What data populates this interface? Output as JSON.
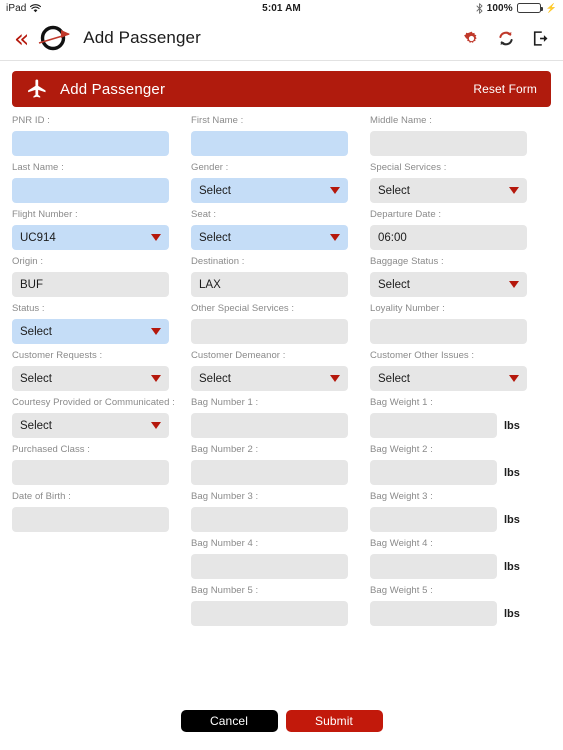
{
  "status_bar": {
    "device": "iPad",
    "wifi_icon": "wifi-icon",
    "time": "5:01 AM",
    "bluetooth_icon": "bluetooth-icon",
    "battery_percent": "100%",
    "battery_icon": "battery-charging-icon"
  },
  "nav": {
    "back_icon": "double-chevron-left-icon",
    "logo_icon": "airline-logo-icon",
    "title": "Add Passenger",
    "actions": [
      {
        "name": "settings-gear-icon",
        "label": "Settings"
      },
      {
        "name": "sync-refresh-icon",
        "label": "Sync"
      },
      {
        "name": "logout-icon",
        "label": "Logout"
      }
    ]
  },
  "panel": {
    "icon": "airplane-icon",
    "title": "Add Passenger",
    "reset_label": "Reset Form",
    "header_color": "#b01b0d"
  },
  "colors": {
    "required_field": "#c5ddf7",
    "optional_field": "#e6e6e6",
    "accent_red": "#b5180c",
    "submit_red": "#c2190b",
    "cancel_black": "#000000"
  },
  "form": {
    "columns": [
      {
        "fields": [
          {
            "label": "PNR ID :",
            "type": "text",
            "value": "",
            "required": true
          },
          {
            "label": "Last Name :",
            "type": "text",
            "value": "",
            "required": true
          },
          {
            "label": "Flight Number :",
            "type": "select",
            "value": "UC914",
            "required": true
          },
          {
            "label": "Origin :",
            "type": "text",
            "value": "BUF",
            "required": false
          },
          {
            "label": "Status :",
            "type": "select",
            "value": "Select",
            "required": true
          },
          {
            "label": "Customer Requests :",
            "type": "select",
            "value": "Select",
            "required": false
          },
          {
            "label": "Courtesy Provided or Communicated :",
            "type": "select",
            "value": "Select",
            "required": false
          },
          {
            "label": "Purchased Class :",
            "type": "text",
            "value": "",
            "required": false
          },
          {
            "label": "Date of Birth :",
            "type": "text",
            "value": "",
            "required": false
          }
        ]
      },
      {
        "fields": [
          {
            "label": "First Name :",
            "type": "text",
            "value": "",
            "required": true
          },
          {
            "label": "Gender :",
            "type": "select",
            "value": "Select",
            "required": true
          },
          {
            "label": "Seat :",
            "type": "select",
            "value": "Select",
            "required": true
          },
          {
            "label": "Destination :",
            "type": "text",
            "value": "LAX",
            "required": false
          },
          {
            "label": "Other Special Services :",
            "type": "text",
            "value": "",
            "required": false
          },
          {
            "label": "Customer Demeanor :",
            "type": "select",
            "value": "Select",
            "required": false
          },
          {
            "label": "Bag Number 1 :",
            "type": "text",
            "value": "",
            "required": false
          },
          {
            "label": "Bag Number 2 :",
            "type": "text",
            "value": "",
            "required": false
          },
          {
            "label": "Bag Number 3 :",
            "type": "text",
            "value": "",
            "required": false
          },
          {
            "label": "Bag Number 4 :",
            "type": "text",
            "value": "",
            "required": false
          },
          {
            "label": "Bag Number 5 :",
            "type": "text",
            "value": "",
            "required": false
          }
        ]
      },
      {
        "fields": [
          {
            "label": "Middle Name :",
            "type": "text",
            "value": "",
            "required": false
          },
          {
            "label": "Special Services :",
            "type": "select",
            "value": "Select",
            "required": false
          },
          {
            "label": "Departure Date :",
            "type": "text",
            "value": "06:00",
            "required": false
          },
          {
            "label": "Baggage Status :",
            "type": "select",
            "value": "Select",
            "required": false
          },
          {
            "label": "Loyality Number :",
            "type": "text",
            "value": "",
            "required": false
          },
          {
            "label": "Customer Other Issues :",
            "type": "select",
            "value": "Select",
            "required": false
          },
          {
            "label": "Bag Weight 1 :",
            "type": "text",
            "value": "",
            "required": false,
            "unit": "lbs"
          },
          {
            "label": "Bag Weight 2 :",
            "type": "text",
            "value": "",
            "required": false,
            "unit": "lbs"
          },
          {
            "label": "Bag Weight 3 :",
            "type": "text",
            "value": "",
            "required": false,
            "unit": "lbs"
          },
          {
            "label": "Bag Weight 4 :",
            "type": "text",
            "value": "",
            "required": false,
            "unit": "lbs"
          },
          {
            "label": "Bag Weight 5 :",
            "type": "text",
            "value": "",
            "required": false,
            "unit": "lbs"
          }
        ]
      }
    ]
  },
  "footer": {
    "cancel_label": "Cancel",
    "submit_label": "Submit"
  }
}
